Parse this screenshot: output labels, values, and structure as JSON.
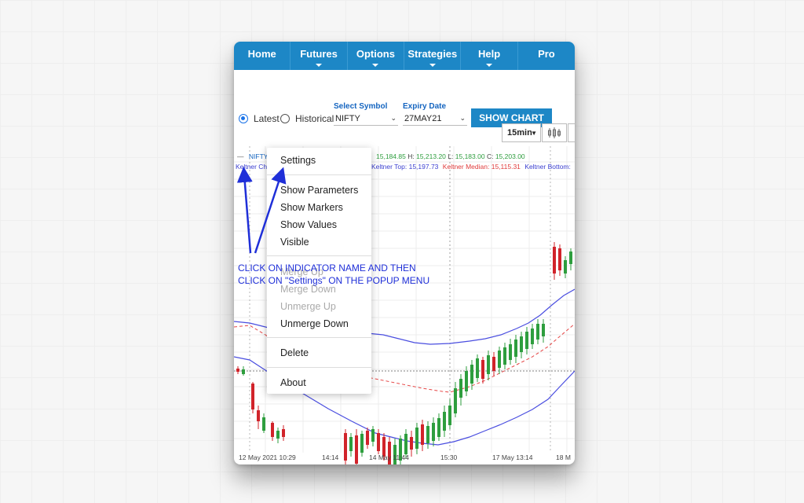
{
  "nav": {
    "items": [
      "Home",
      "Futures",
      "Options",
      "Strategies",
      "Help",
      "Pro"
    ]
  },
  "controls": {
    "radio_latest": "Latest",
    "radio_historical": "Historical",
    "symbol_label": "Select Symbol",
    "symbol_value": "NIFTY",
    "expiry_label": "Expiry Date",
    "expiry_value": "27MAY21",
    "show_chart": "SHOW CHART",
    "timeframe": "15min"
  },
  "legend": {
    "symbol": "NIFTY",
    "open": "15,184.85",
    "h_label": "H:",
    "high": "15,213.20",
    "l_label": "L:",
    "low": "15,183.00",
    "c_label": "C:",
    "close": "15,203.00",
    "indicator": "Keltner Ch",
    "top_label": "Keltner Top:",
    "top_value": "15,197.73",
    "median_label": "Keltner Median:",
    "median_value": "15,115.31",
    "bottom_label": "Keltner Bottom:"
  },
  "context_menu": {
    "settings": "Settings",
    "show_parameters": "Show Parameters",
    "show_markers": "Show Markers",
    "show_values": "Show Values",
    "visible": "Visible",
    "merge_up": "Merge Up",
    "merge_down": "Merge Down",
    "unmerge_up": "Unmerge Up",
    "unmerge_down": "Unmerge Down",
    "delete": "Delete",
    "about": "About"
  },
  "annotation": {
    "line1": "CLICK ON INDICATOR NAME AND THEN",
    "line2": "CLICK ON \"Settings\" ON THE POPUP MENU"
  },
  "x_axis": [
    "12 May 2021 10:29",
    "14:14",
    "14 May 11:44",
    "15:30",
    "17 May 13:14",
    "18 M"
  ],
  "colors": {
    "nav": "#1d87c6",
    "up": "#2e9e3e",
    "down": "#d1232a",
    "band": "#4a4ee0",
    "median": "#e64545",
    "annotation": "#1f2fd8"
  }
}
